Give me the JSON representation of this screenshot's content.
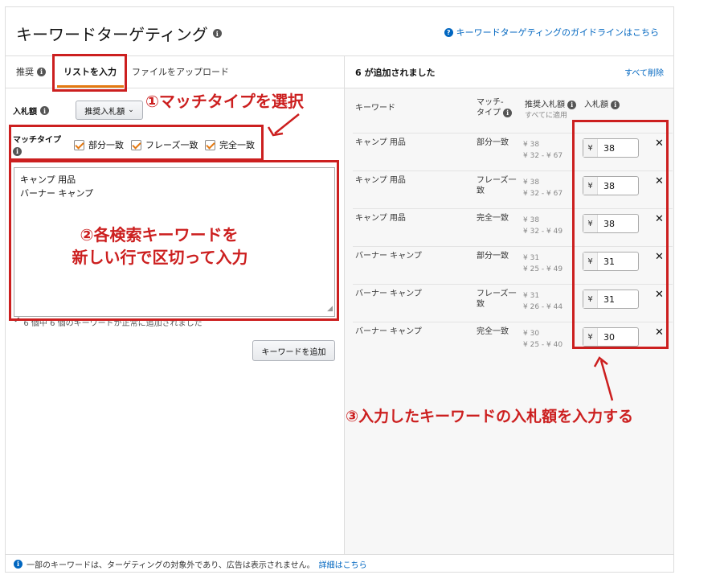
{
  "header": {
    "title": "キーワードターゲティング",
    "guide_link": "キーワードターゲティングのガイドラインはこちら"
  },
  "tabs": [
    {
      "label": "推奨"
    },
    {
      "label": "リストを入力"
    },
    {
      "label": "ファイルをアップロード"
    }
  ],
  "left": {
    "bid_label": "入札額",
    "bid_select": "推奨入札額",
    "match_label_1": "マッチタイプ",
    "match_types": [
      "部分一致",
      "フレーズ一致",
      "完全一致"
    ],
    "keywords_text": [
      "キャンプ 用品",
      "バーナー キャンプ"
    ],
    "success_text": "6 個中 6 個のキーワードが正常に追加されました",
    "add_button": "キーワードを追加"
  },
  "right": {
    "added_count": "6 が追加されました",
    "remove_all": "すべて削除",
    "col_keyword": "キーワード",
    "col_match_1": "マッチ-",
    "col_match_2": "タイプ",
    "col_suggested": "推奨入札額",
    "col_apply_all": "すべてに適用",
    "col_bid": "入札額",
    "currency": "¥",
    "rows": [
      {
        "keyword": "キャンプ 用品",
        "match": "部分一致",
        "match2": "",
        "sug1": "¥ 38",
        "sug2": "¥ 32 - ¥ 67",
        "bid": "38"
      },
      {
        "keyword": "キャンプ 用品",
        "match": "フレーズ一",
        "match2": "致",
        "sug1": "¥ 38",
        "sug2": "¥ 32 - ¥ 67",
        "bid": "38"
      },
      {
        "keyword": "キャンプ 用品",
        "match": "完全一致",
        "match2": "",
        "sug1": "¥ 38",
        "sug2": "¥ 32 - ¥ 49",
        "bid": "38"
      },
      {
        "keyword": "バーナー キャンプ",
        "match": "部分一致",
        "match2": "",
        "sug1": "¥ 31",
        "sug2": "¥ 25 - ¥ 49",
        "bid": "31"
      },
      {
        "keyword": "バーナー キャンプ",
        "match": "フレーズ一",
        "match2": "致",
        "sug1": "¥ 31",
        "sug2": "¥ 26 - ¥ 44",
        "bid": "31"
      },
      {
        "keyword": "バーナー キャンプ",
        "match": "完全一致",
        "match2": "",
        "sug1": "¥ 30",
        "sug2": "¥ 25 - ¥ 40",
        "bid": "30"
      }
    ]
  },
  "footer": {
    "text": "一部のキーワードは、ターゲティングの対象外であり、広告は表示されません。",
    "link": "詳細はこちら"
  },
  "annotations": {
    "step1": "①マッチタイプを選択",
    "step2_line1": "②各検索キーワードを",
    "step2_line2": "新しい行で区切って入力",
    "step3": "③入力したキーワードの入札額を入力する"
  },
  "colors": {
    "annotation_red": "#cc1f1f",
    "link_blue": "#0066c0",
    "tab_orange": "#e47911"
  }
}
